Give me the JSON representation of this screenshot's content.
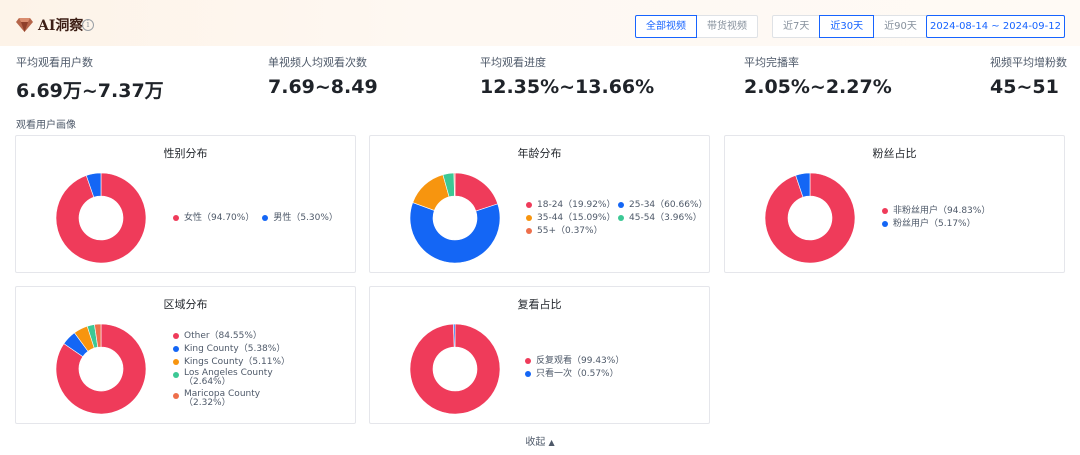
{
  "header": {
    "title": "AI洞察",
    "info_icon": "info-circle-icon",
    "logo_icon": "diamond-icon",
    "type_tabs": [
      {
        "label": "全部视频",
        "active": true
      },
      {
        "label": "带货视频",
        "active": false
      }
    ],
    "period_tabs": [
      {
        "label": "近7天",
        "active": false
      },
      {
        "label": "近30天",
        "active": true
      },
      {
        "label": "近90天",
        "active": false
      }
    ],
    "date_range": "2024-08-14 ~ 2024-09-12"
  },
  "metrics": [
    {
      "label": "平均观看用户数",
      "value": "6.69万~7.37万"
    },
    {
      "label": "单视频人均观看次数",
      "value": "7.69~8.49"
    },
    {
      "label": "平均观看进度",
      "value": "12.35%~13.66%"
    },
    {
      "label": "平均完播率",
      "value": "2.05%~2.27%"
    },
    {
      "label": "视频平均增粉数",
      "value": "45~51"
    }
  ],
  "section_label": "观看用户画像",
  "collapse_label": "收起",
  "colors": {
    "red": "#ef3b5a",
    "blue": "#1466f5",
    "orange": "#f7950f",
    "green": "#3cc895",
    "coral": "#ee6f4b",
    "accent": "#1764ff"
  },
  "chart_data": [
    {
      "type": "pie",
      "title": "性别分布",
      "slices": [
        {
          "name": "女性",
          "value": 94.7,
          "label": "女性（94.70%）",
          "color": "#ef3b5a"
        },
        {
          "name": "男性",
          "value": 5.3,
          "label": "男性（5.30%）",
          "color": "#1466f5"
        }
      ]
    },
    {
      "type": "pie",
      "title": "年龄分布",
      "slices": [
        {
          "name": "18-24",
          "value": 19.92,
          "label": "18-24（19.92%）",
          "color": "#ef3b5a"
        },
        {
          "name": "25-34",
          "value": 60.66,
          "label": "25-34（60.66%）",
          "color": "#1466f5"
        },
        {
          "name": "35-44",
          "value": 15.09,
          "label": "35-44（15.09%）",
          "color": "#f7950f"
        },
        {
          "name": "45-54",
          "value": 3.96,
          "label": "45-54（3.96%）",
          "color": "#3cc895"
        },
        {
          "name": "55+",
          "value": 0.37,
          "label": "55+（0.37%）",
          "color": "#ee6f4b"
        }
      ]
    },
    {
      "type": "pie",
      "title": "粉丝占比",
      "slices": [
        {
          "name": "非粉丝用户",
          "value": 94.83,
          "label": "非粉丝用户（94.83%）",
          "color": "#ef3b5a"
        },
        {
          "name": "粉丝用户",
          "value": 5.17,
          "label": "粉丝用户（5.17%）",
          "color": "#1466f5"
        }
      ]
    },
    {
      "type": "pie",
      "title": "区域分布",
      "slices": [
        {
          "name": "Other",
          "value": 84.55,
          "label": "Other（84.55%）",
          "color": "#ef3b5a"
        },
        {
          "name": "King County",
          "value": 5.38,
          "label": "King County（5.38%）",
          "color": "#1466f5"
        },
        {
          "name": "Kings County",
          "value": 5.11,
          "label": "Kings County（5.11%）",
          "color": "#f7950f"
        },
        {
          "name": "Los Angeles County",
          "value": 2.64,
          "label": "Los Angeles County（2.64%）",
          "color": "#3cc895"
        },
        {
          "name": "Maricopa County",
          "value": 2.32,
          "label": "Maricopa County（2.32%）",
          "color": "#ee6f4b"
        }
      ]
    },
    {
      "type": "pie",
      "title": "复看占比",
      "slices": [
        {
          "name": "反复观看",
          "value": 99.43,
          "label": "反复观看（99.43%）",
          "color": "#ef3b5a"
        },
        {
          "name": "只看一次",
          "value": 0.57,
          "label": "只看一次（0.57%）",
          "color": "#1466f5"
        }
      ]
    }
  ]
}
